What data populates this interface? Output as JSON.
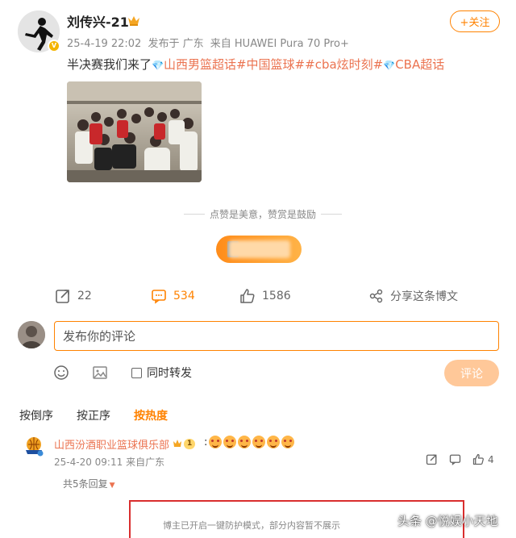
{
  "author": {
    "name": "刘传兴-21",
    "timestamp": "25-4-19 22:02",
    "location": "发布于 广东",
    "device": "来自 HUAWEI Pura 70 Pro+",
    "follow_label": "+关注",
    "verified_badge": "V"
  },
  "post": {
    "text": "半决赛我们来了",
    "topics": [
      "山西男篮超话",
      "#中国篮球#",
      "#cba炫时刻#",
      "CBA超话"
    ]
  },
  "reward": {
    "tagline": "点赞是美意，赞赏是鼓励"
  },
  "actions": {
    "repost_count": "22",
    "comment_count": "534",
    "like_count": "1586",
    "share_label": "分享这条博文"
  },
  "composer": {
    "placeholder": "发布你的评论",
    "repost_checkbox_label": "同时转发",
    "submit_label": "评论"
  },
  "sort_tabs": [
    {
      "label": "按倒序",
      "active": false
    },
    {
      "label": "按正序",
      "active": false
    },
    {
      "label": "按热度",
      "active": true
    }
  ],
  "comment": {
    "author": "山西汾酒职业篮球俱乐部",
    "level": "1",
    "separator": ":",
    "emoji_count": 6,
    "timestamp": "25-4-20 09:11",
    "source": "来自广东",
    "like_count": "4",
    "replies_label": "共5条回复"
  },
  "notice": {
    "text": "博主已开启一键防护模式，部分内容暂不展示"
  },
  "watermark": "头条 @悦娱小天地",
  "colors": {
    "accent": "#ff8200",
    "topic": "#eb7350",
    "notice_border": "#d92e2e",
    "submit_disabled": "#ffc899"
  }
}
